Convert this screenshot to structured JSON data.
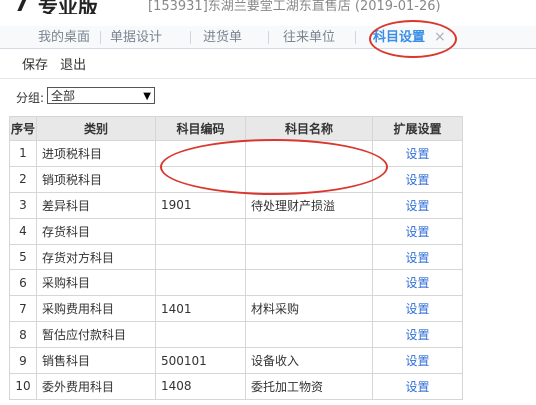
{
  "header": {
    "logo_mark": "7",
    "app_title": "专业版",
    "store_info": "[153931]东湖兰要堂工湖东直售店   (2019-01-26)"
  },
  "tabs": [
    {
      "label": "我的桌面"
    },
    {
      "label": "单据设计"
    },
    {
      "label": "进货单"
    },
    {
      "label": "往来单位"
    },
    {
      "label": "科目设置",
      "close": "×"
    }
  ],
  "toolbar": {
    "save_label": "保存",
    "exit_label": "退出"
  },
  "filter": {
    "group_label": "分组:",
    "group_value": "全部",
    "arrow": "▼"
  },
  "table": {
    "headers": {
      "seq": "序号",
      "category": "类别",
      "code": "科目编码",
      "name": "科目名称",
      "extend": "扩展设置"
    },
    "rows": [
      {
        "seq": "1",
        "category": "进项税科目",
        "code": "",
        "name": "",
        "extend": "设置"
      },
      {
        "seq": "2",
        "category": "销项税科目",
        "code": "",
        "name": "",
        "extend": "设置"
      },
      {
        "seq": "3",
        "category": "差异科目",
        "code": "1901",
        "name": "待处理财产损溢",
        "extend": "设置"
      },
      {
        "seq": "4",
        "category": "存货科目",
        "code": "",
        "name": "",
        "extend": "设置"
      },
      {
        "seq": "5",
        "category": "存货对方科目",
        "code": "",
        "name": "",
        "extend": "设置"
      },
      {
        "seq": "6",
        "category": "采购科目",
        "code": "",
        "name": "",
        "extend": "设置"
      },
      {
        "seq": "7",
        "category": "采购费用科目",
        "code": "1401",
        "name": "材料采购",
        "extend": "设置"
      },
      {
        "seq": "8",
        "category": "暂估应付款科目",
        "code": "",
        "name": "",
        "extend": "设置"
      },
      {
        "seq": "9",
        "category": "销售科目",
        "code": "500101",
        "name": "设备收入",
        "extend": "设置"
      },
      {
        "seq": "10",
        "category": "委外费用科目",
        "code": "1408",
        "name": "委托加工物资",
        "extend": "设置"
      }
    ]
  },
  "colors": {
    "accent": "#3a8ee6",
    "annotation": "#d9382e",
    "link": "#2f6fd6"
  }
}
